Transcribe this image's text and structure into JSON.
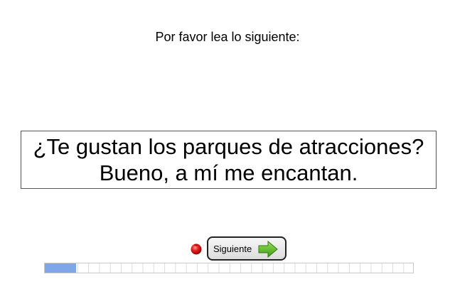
{
  "instruction": "Por favor lea lo siguiente:",
  "prompt": {
    "line1": "¿Te gustan los parques de atracciones?",
    "line2": "Bueno, a mí me encantan."
  },
  "controls": {
    "record_icon": "record-indicator-icon",
    "next_label": "Siguiente",
    "next_icon": "green-right-arrow-icon"
  },
  "progress": {
    "fraction": 0.085,
    "segments": 34
  },
  "colors": {
    "progress_fill": "#7ea6e8",
    "record": "#e02020",
    "arrow": "#4caf1e"
  }
}
